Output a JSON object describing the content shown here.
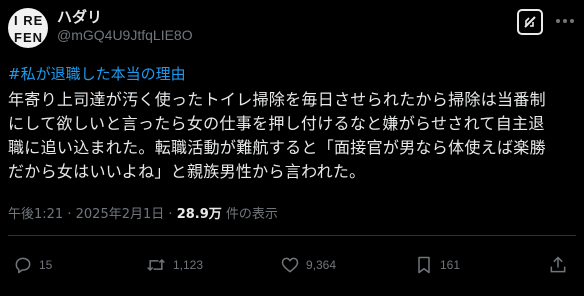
{
  "author": {
    "display_name": "ハダリ",
    "handle": "@mGQ4U9JtfqLIE8O",
    "avatar_text_line1": "I RE",
    "avatar_text_line2": "FEN"
  },
  "header_icons": {
    "grok": "grok-icon",
    "more": "more-icon"
  },
  "post": {
    "hashtag": "#私が退職した本当の理由",
    "lines": [
      "年寄り上司達が汚く使ったトイレ掃除を毎日させられたから掃除は当番制",
      "にして欲しいと言ったら女の仕事を押し付けるなと嫌がらせされて自主退",
      "職に追い込まれた。転職活動が難航すると「面接官が男なら体使えば楽勝",
      "だから女はいいよね」と親族男性から言われた。"
    ]
  },
  "meta": {
    "time": "午後1:21",
    "sep1": "·",
    "date": "2025年2月1日",
    "sep2": "·",
    "views_count": "28.9万",
    "views_label": " 件の表示"
  },
  "actions": {
    "reply_count": "15",
    "retweet_count": "1,123",
    "like_count": "9,364",
    "bookmark_count": "161",
    "icons": [
      "reply-icon",
      "retweet-icon",
      "like-icon",
      "bookmark-icon",
      "share-icon"
    ]
  },
  "colors": {
    "background": "#000000",
    "text": "#e7e9ea",
    "secondary": "#71767b",
    "link": "#1d9bf0",
    "divider": "#2f3336"
  }
}
